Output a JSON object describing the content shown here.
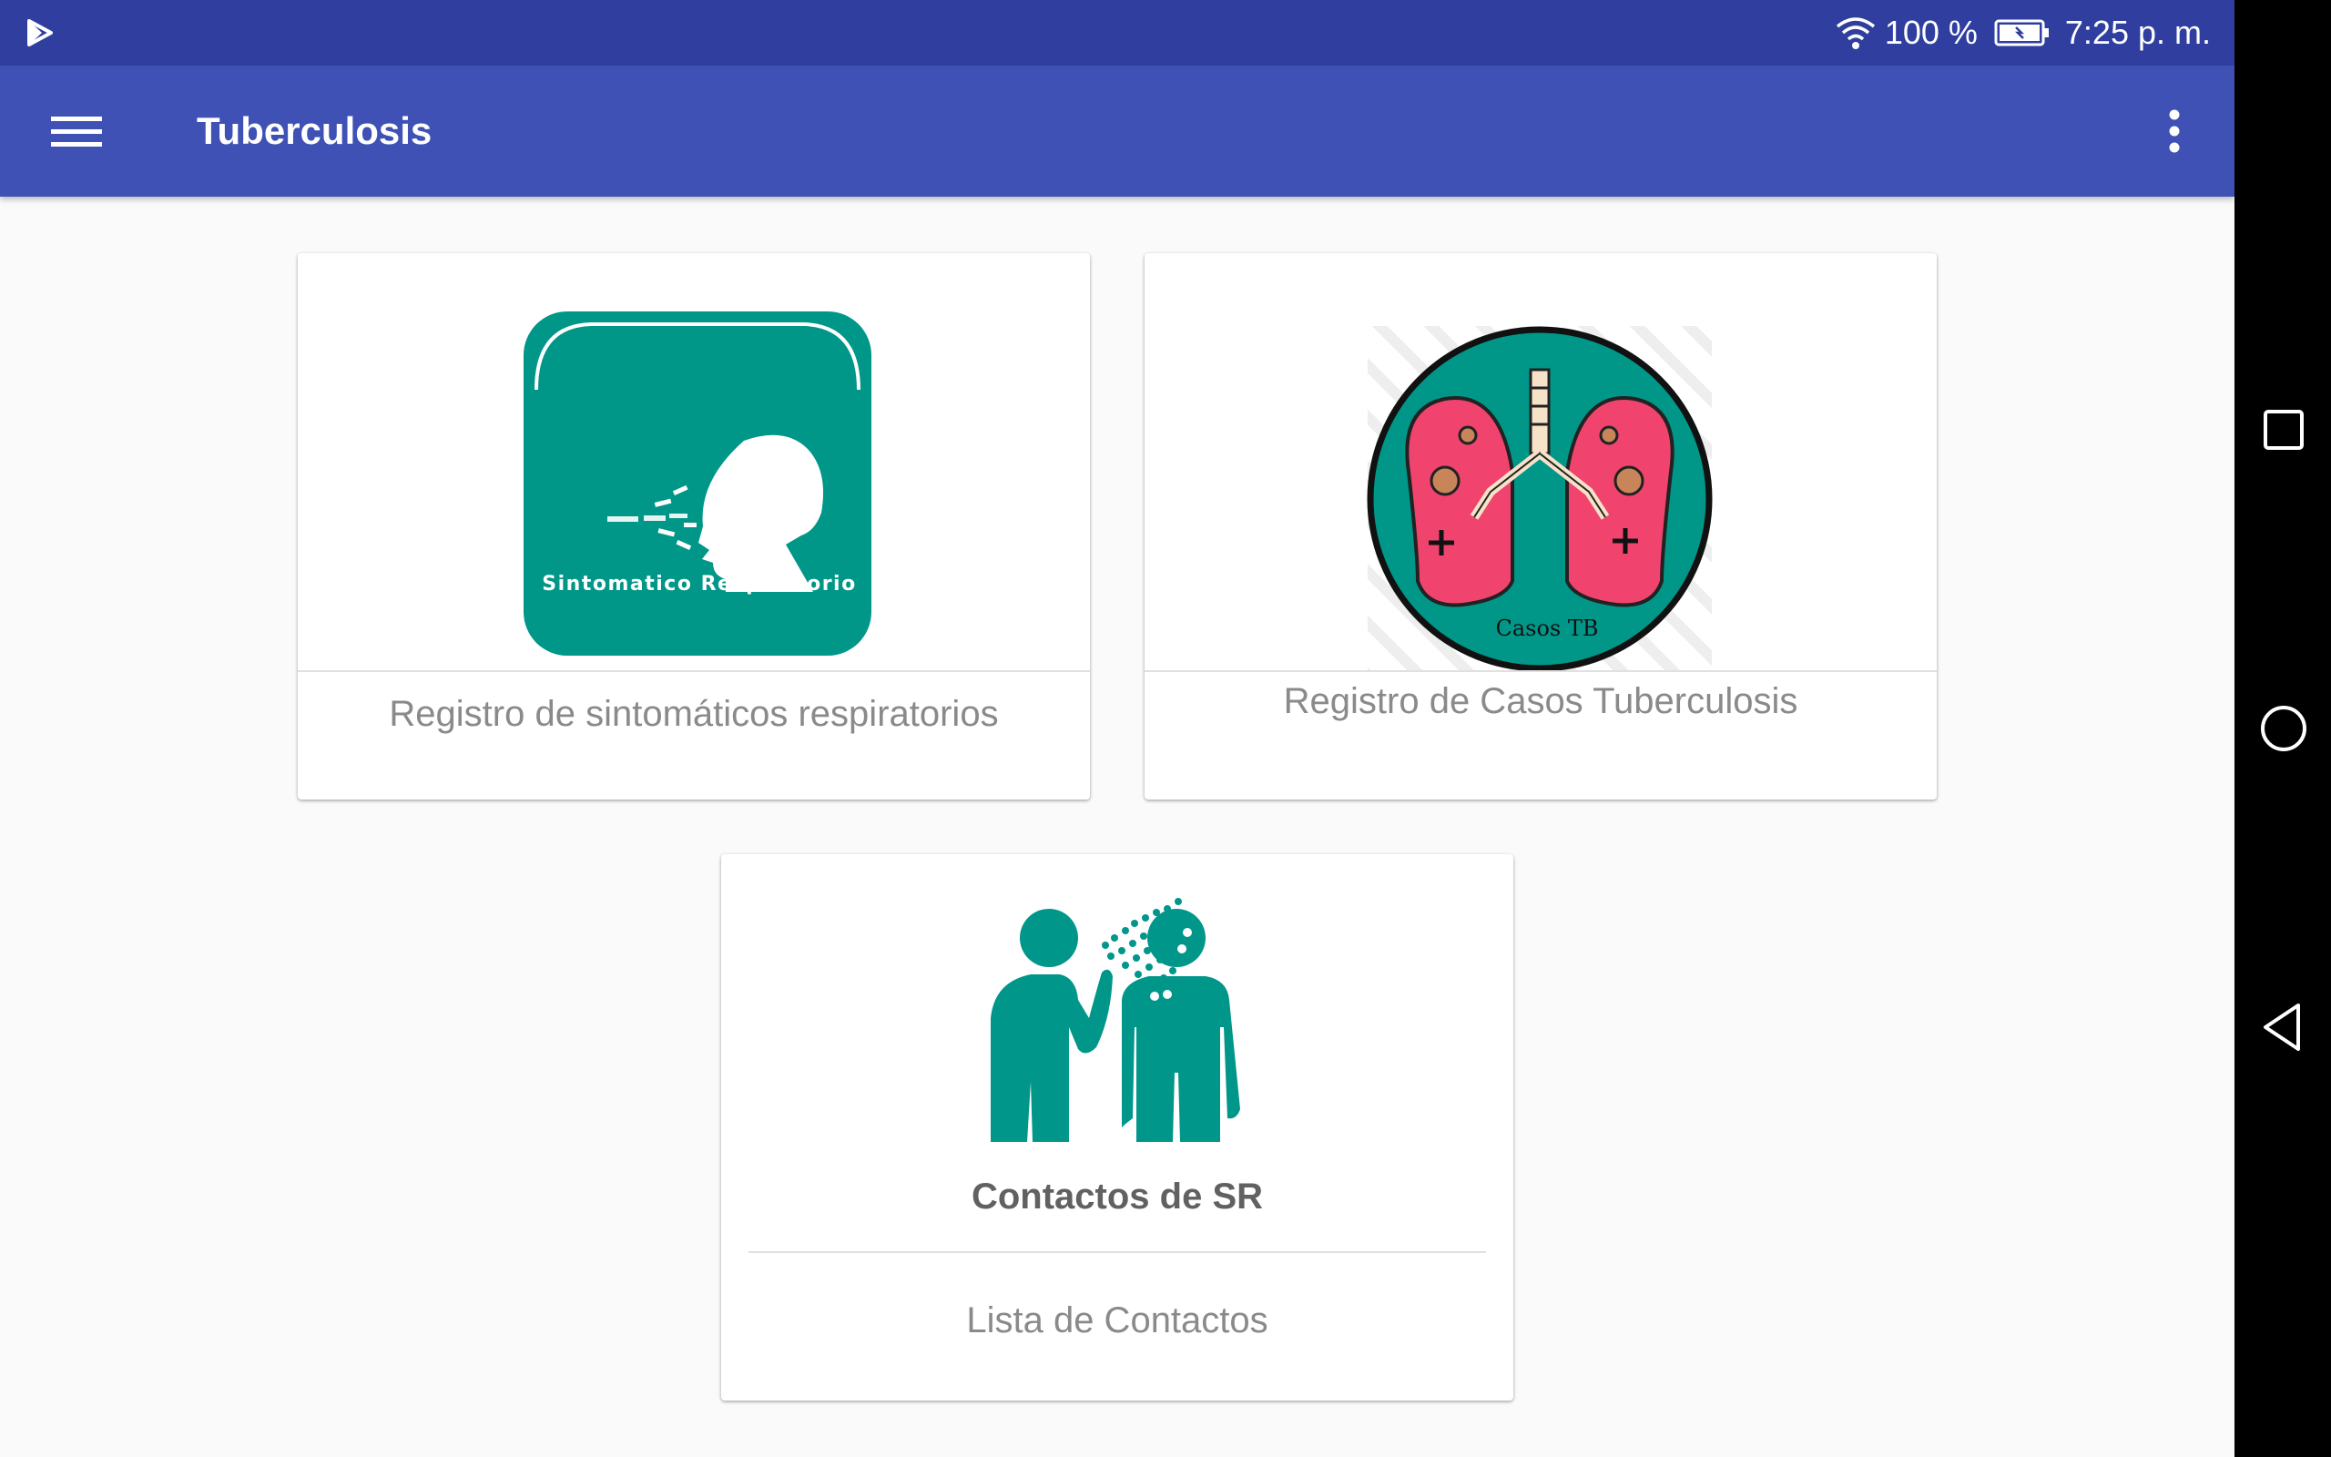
{
  "status_bar": {
    "battery": "100 %",
    "time": "7:25 p. m.",
    "background": "#303f9f"
  },
  "app_bar": {
    "title": "Tuberculosis",
    "background": "#3f51b5"
  },
  "accent": "#00968a",
  "cards": [
    {
      "image_text": "Sintomatico Respiratorio",
      "caption": "Registro de sintomáticos respiratorios"
    },
    {
      "image_text": "Casos TB",
      "caption": "Registro de Casos Tuberculosis"
    },
    {
      "title": "Contactos de SR",
      "caption": "Lista de Contactos"
    }
  ]
}
